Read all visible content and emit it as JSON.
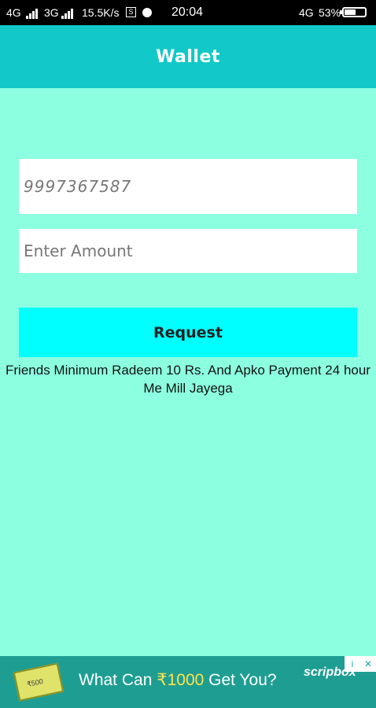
{
  "status_bar": {
    "net1": "4G",
    "net2": "3G",
    "speed": "15.5K/s",
    "time": "20:04",
    "net_right": "4G",
    "battery": "53%"
  },
  "header": {
    "title": "Wallet"
  },
  "form": {
    "phone_value": "9997367587",
    "amount_placeholder": "Enter Amount",
    "request_label": "Request"
  },
  "info_text": "Friends Minimum Radeem 10 Rs. And Apko Payment 24 hour Me Mill Jayega",
  "ad": {
    "headline_pre": "What Can ",
    "headline_amount": "₹1000",
    "headline_post": " Get You?",
    "brand": "scripbox",
    "ticket_label": "₹500",
    "info_icon": "i",
    "close_icon": "✕"
  },
  "colors": {
    "background": "#8cffe0",
    "appbar": "#12c8c8",
    "button": "#00ffff"
  }
}
